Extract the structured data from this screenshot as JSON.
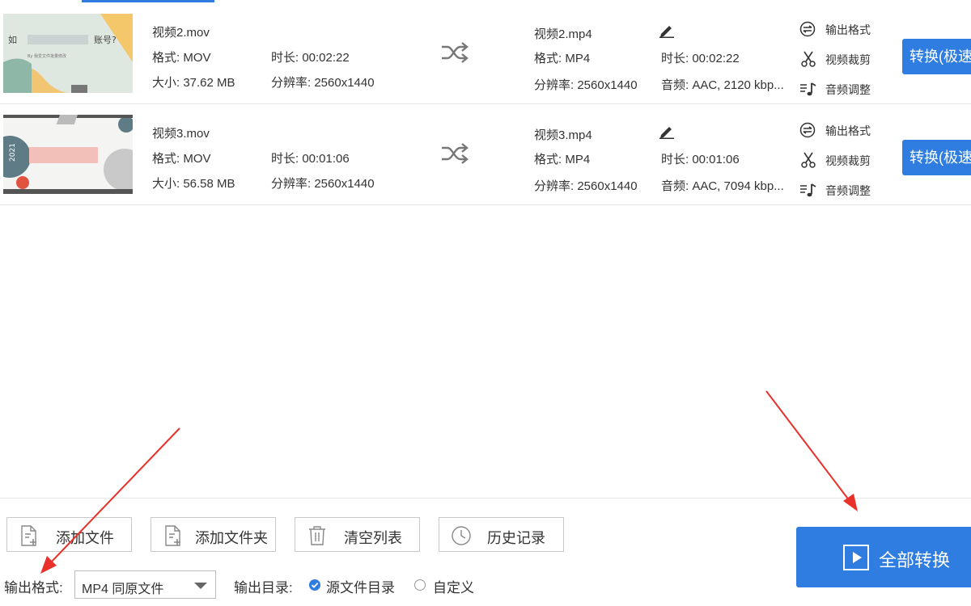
{
  "files": [
    {
      "src_name": "视频2.mov",
      "src_format": "格式: MOV",
      "src_duration": "时长: 00:02:22",
      "src_size": "大小: 37.62 MB",
      "src_resolution": "分辨率: 2560x1440",
      "out_name": "视频2.mp4",
      "out_format": "格式: MP4",
      "out_duration": "时长: 00:02:22",
      "out_resolution": "分辨率: 2560x1440",
      "out_audio": "音频: AAC, 2120 kbp...",
      "thumb_title": "如",
      "thumb_suffix": "账号?",
      "thumb_caption": "By 我爱文件批量修改"
    },
    {
      "src_name": "视频3.mov",
      "src_format": "格式: MOV",
      "src_duration": "时长: 00:01:06",
      "src_size": "大小: 56.58 MB",
      "src_resolution": "分辨率: 2560x1440",
      "out_name": "视频3.mp4",
      "out_format": "格式: MP4",
      "out_duration": "时长: 00:01:06",
      "out_resolution": "分辨率: 2560x1440",
      "out_audio": "音频: AAC, 7094 kbp...",
      "thumb_year": "2021"
    }
  ],
  "actions": {
    "output_format": "输出格式",
    "video_crop": "视频裁剪",
    "audio_adjust": "音频调整",
    "convert": "转换(极速"
  },
  "toolbar": {
    "add_file": "添加文件",
    "add_folder": "添加文件夹",
    "clear_list": "清空列表",
    "history": "历史记录"
  },
  "convert_all": "全部转换",
  "output": {
    "format_label": "输出格式:",
    "format_value": "MP4 同原文件",
    "dir_label": "输出目录:",
    "dir_source": "源文件目录",
    "dir_custom": "自定义",
    "dir_selected": "源文件目录"
  },
  "colors": {
    "accent": "#2f7de1",
    "annotation_arrow": "#e8312a"
  },
  "icons": [
    "shuffle-icon",
    "edit-pen-icon",
    "output-format-icon",
    "scissors-icon",
    "audio-note-icon",
    "add-file-icon",
    "add-folder-icon",
    "trash-icon",
    "clock-icon",
    "play-icon"
  ]
}
